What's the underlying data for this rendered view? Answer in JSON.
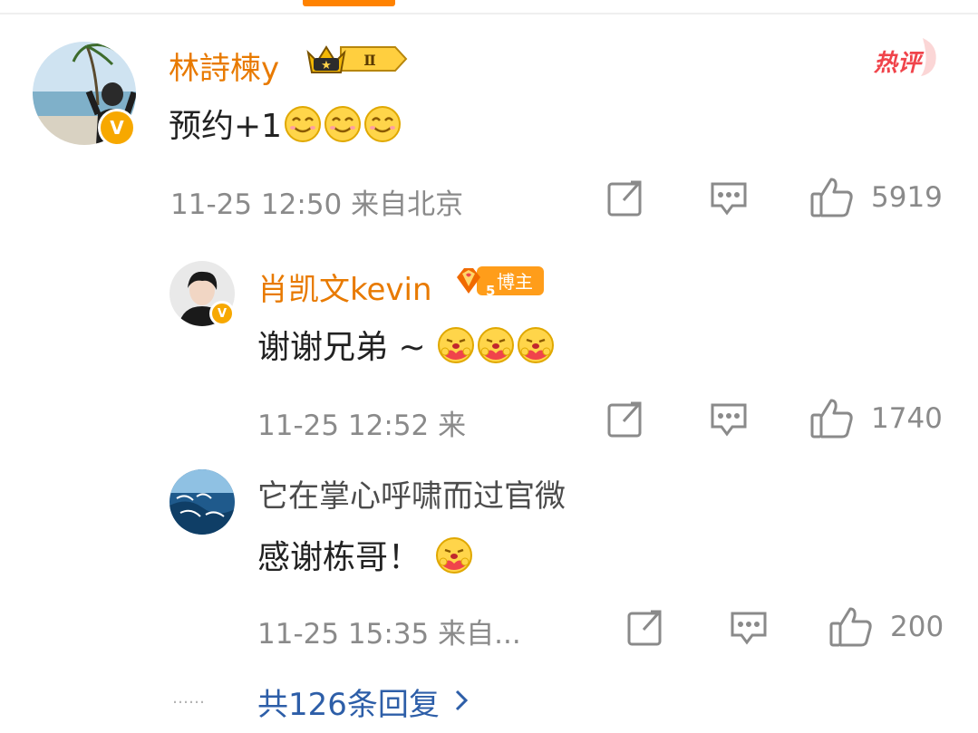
{
  "header": {
    "accent": "#ff8200"
  },
  "comment1": {
    "user": "林詩楝y",
    "level_badge": "Ⅱ",
    "hot_label": "热评",
    "text": "预约+1",
    "emoji": [
      "smile-emoji",
      "smile-emoji",
      "smile-emoji"
    ],
    "time": "11-25 12:50 来自北京",
    "likes": "5919",
    "icons": {
      "share": "share-icon",
      "comment": "comment-icon",
      "like": "like-icon"
    }
  },
  "reply1": {
    "user": "肖凯文kevin",
    "badge_level": "5",
    "badge_label": "博主",
    "text": "谢谢兄弟 ~",
    "emoji": [
      "hug-emoji",
      "hug-emoji",
      "hug-emoji"
    ],
    "time": "11-25 12:52 来",
    "likes": "1740"
  },
  "reply2": {
    "user": "它在掌心呼啸而过官微",
    "text": "感谢栋哥！",
    "emoji": [
      "hug-emoji"
    ],
    "time": "11-25 15:35 来自...",
    "likes": "200"
  },
  "footer": {
    "dots": "……",
    "more_replies": "共126条回复",
    "chevron": "chevron-right-icon"
  },
  "colors": {
    "username": "#e87a00",
    "meta": "#8a8a8a",
    "link": "#2d5ea8",
    "vip": "#f7a800"
  }
}
